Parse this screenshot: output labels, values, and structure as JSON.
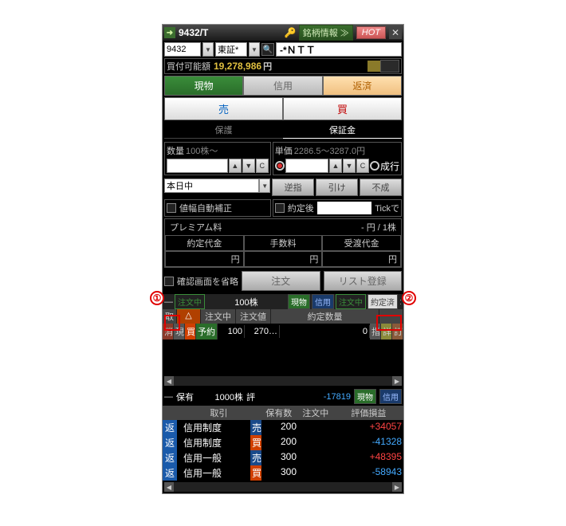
{
  "title": "9432/T",
  "stock_info_label": "銘柄情報 ≫",
  "hot_label": "HOT",
  "code": "9432",
  "market": "東証*",
  "stock_name": "-*ＮＴＴ",
  "funds": {
    "label": "買付可能額",
    "value": "19,278,986",
    "unit": "円"
  },
  "trade_tabs": [
    "現物",
    "信用",
    "返済"
  ],
  "bs_tabs": [
    "売",
    "買"
  ],
  "sub_tabs": [
    "保護",
    "保証金"
  ],
  "qty": {
    "label": "数量",
    "hint": "100株～"
  },
  "unit": {
    "label": "単価",
    "hint": "2286.5～3287.0円"
  },
  "market_order": "成行",
  "validity": "本日中",
  "ext_btns": [
    "逆指",
    "引け",
    "不成"
  ],
  "tick_row": {
    "chk": "約定後",
    "label": "Tickで"
  },
  "auto_adj": "値幅自動補正",
  "premium": {
    "title": "プレミアム料",
    "unit": "- 円 / 1株",
    "cols": [
      "約定代金",
      "手数料",
      "受渡代金"
    ],
    "suffix": "円"
  },
  "confirm_skip": "確認画面を省略",
  "order_btn": "注文",
  "list_btn": "リスト登録",
  "orders_header": {
    "status": "注文中",
    "shares": "100株",
    "tabs": [
      "現物",
      "信用",
      "注文中",
      "約定済"
    ]
  },
  "orders_th": [
    "取",
    "",
    "",
    "注文中",
    "注文値",
    "約定数量",
    "",
    ""
  ],
  "orders_sort_col": "△",
  "order_row": {
    "cancel": "消",
    "type1": "現",
    "type2": "買",
    "status": "予約",
    "qty": "100",
    "price": "270…",
    "filled": "0",
    "a": "指",
    "b": "詳",
    "c": "訂"
  },
  "callouts": [
    "①",
    "②"
  ],
  "holdings_header": {
    "label": "保有",
    "shares": "1000株",
    "eval_label": "評",
    "eval_val": "-17819",
    "tabs": [
      "現物",
      "信用"
    ]
  },
  "holdings_th": [
    "取引",
    "保有数",
    "注文中",
    "評価損益"
  ],
  "holdings_rows": [
    {
      "btn": "返",
      "name": "信用制度",
      "bs": "売",
      "bs_class": "sell",
      "qty": "200",
      "ord": "",
      "pl": "+34057",
      "pl_class": "c-red"
    },
    {
      "btn": "返",
      "name": "信用制度",
      "bs": "買",
      "bs_class": "buy",
      "qty": "200",
      "ord": "",
      "pl": "-41328",
      "pl_class": "c-blue"
    },
    {
      "btn": "返",
      "name": "信用一般",
      "bs": "売",
      "bs_class": "sell",
      "qty": "300",
      "ord": "",
      "pl": "+48395",
      "pl_class": "c-red"
    },
    {
      "btn": "返",
      "name": "信用一般",
      "bs": "買",
      "bs_class": "buy",
      "qty": "300",
      "ord": "",
      "pl": "-58943",
      "pl_class": "c-blue"
    }
  ]
}
